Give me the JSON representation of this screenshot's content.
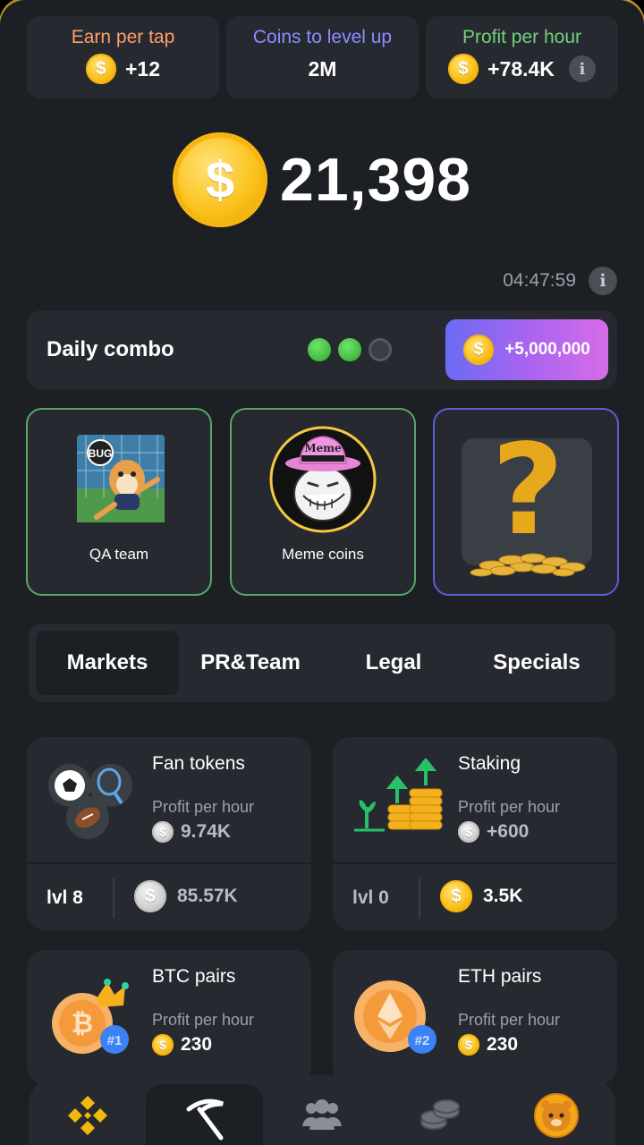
{
  "stats": [
    {
      "label": "Earn per tap",
      "value": "+12",
      "label_color": "#ff9d6e"
    },
    {
      "label": "Coins to level up",
      "value": "2M",
      "label_color": "#8a8cff"
    },
    {
      "label": "Profit per hour",
      "value": "+78.4K",
      "label_color": "#73d07a"
    }
  ],
  "balance": "21,398",
  "timer": "04:47:59",
  "combo": {
    "title": "Daily combo",
    "reward": "+5,000,000",
    "dots": [
      "found",
      "found",
      "empty"
    ]
  },
  "combo_cards": [
    {
      "label": "QA team",
      "art_text": "BUG"
    },
    {
      "label": "Meme coins",
      "art_text": "Meme"
    },
    {
      "label": "",
      "art_text": "?"
    }
  ],
  "tabs": [
    "Markets",
    "PR&Team",
    "Legal",
    "Specials"
  ],
  "active_tab": "Markets",
  "markets": [
    {
      "name": "Fan tokens",
      "pph_label": "Profit per hour",
      "pph": "9.74K",
      "level": "lvl 8",
      "cost": "85.57K",
      "affordable": false
    },
    {
      "name": "Staking",
      "pph_label": "Profit per hour",
      "pph": "+600",
      "level": "lvl 0",
      "cost": "3.5K",
      "affordable": true
    },
    {
      "name": "BTC pairs",
      "pph_label": "Profit per hour",
      "pph": "230",
      "badge": "#1"
    },
    {
      "name": "ETH pairs",
      "pph_label": "Profit per hour",
      "pph": "230",
      "badge": "#2"
    }
  ],
  "coin_symbol": "$",
  "info_symbol": "i",
  "nav": [
    {
      "icon": "exchange-icon"
    },
    {
      "icon": "mine-pickaxe-icon",
      "active": true
    },
    {
      "icon": "friends-icon"
    },
    {
      "icon": "earn-coins-icon"
    },
    {
      "icon": "airdrop-hamster-coin-icon"
    }
  ]
}
